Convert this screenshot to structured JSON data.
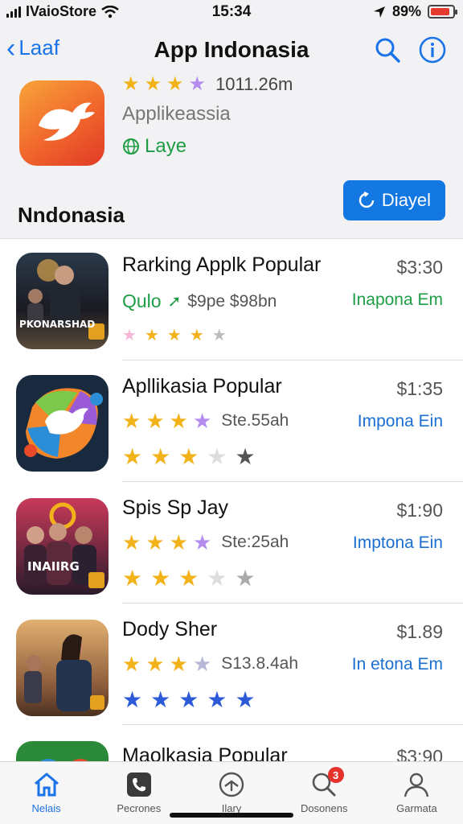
{
  "status": {
    "carrier": "IVaioStore",
    "time": "15:34",
    "battery": "89%",
    "battery_level": 0.89
  },
  "nav": {
    "back_label": "Laaf",
    "title": "App Indonasia",
    "search_icon": "search-icon",
    "info_icon": "info-icon"
  },
  "header": {
    "rating_value": "1011.26m",
    "stars": [
      "#f2b21a",
      "#f2b21a",
      "#f2b21a",
      "#b48cf0"
    ],
    "subtitle": "Applikeassia",
    "tag": "Laye",
    "tag_color": "#1f9d45",
    "install_label": "Diayel",
    "section_title": "Nndonasia"
  },
  "list": [
    {
      "title": "Rarking Applk Popular",
      "price": "$3:30",
      "logo": "Qulo",
      "meta": "$9pe $98bn",
      "link": "Inapona Em",
      "link_color": "#1f9d45",
      "stars": [
        "#f6b8d6",
        "#f2b21a",
        "#f2b21a",
        "#f2b21a",
        "#bbbbbb"
      ],
      "thumb_caption": "PKONARSHAD"
    },
    {
      "title": "Apllikasia Popular",
      "price": "$1:35",
      "meta": "Ste.55ah",
      "link": "Impona Ein",
      "link_color": "#1b6fd1",
      "stars": [
        "#f2b21a",
        "#f2b21a",
        "#f2b21a",
        "#b48cf0"
      ],
      "stars2": [
        "#f2b21a",
        "#f2b21a",
        "#f2b21a",
        "#dddddd",
        "#555555"
      ]
    },
    {
      "title": "Spis Sp Jay",
      "price": "$1:90",
      "meta": "Ste:25ah",
      "link": "Imptona Ein",
      "link_color": "#1b6fd1",
      "stars": [
        "#f2b21a",
        "#f2b21a",
        "#f2b21a",
        "#b48cf0"
      ],
      "stars2": [
        "#f2b21a",
        "#f2b21a",
        "#f2b21a",
        "#dddddd",
        "#aaaaaa"
      ],
      "thumb_caption": "INAIIRG"
    },
    {
      "title": "Dody Sher",
      "price": "$1.89",
      "meta": "S13.8.4ah",
      "link": "In etona Em",
      "link_color": "#1b6fd1",
      "stars": [
        "#f2b21a",
        "#f2b21a",
        "#f2b21a",
        "#b7b7d6"
      ],
      "stars2": [
        "#2d5bd8",
        "#2d5bd8",
        "#2d5bd8",
        "#2d5bd8",
        "#2d5bd8"
      ]
    },
    {
      "title": "Maolkasia Popular",
      "price": "$3:90"
    }
  ],
  "tabs": [
    {
      "label": "Nelais",
      "icon": "home-icon",
      "active": true
    },
    {
      "label": "Pecrones",
      "icon": "phone-icon"
    },
    {
      "label": "Ilary",
      "icon": "compass-icon"
    },
    {
      "label": "Dosonens",
      "icon": "search-icon",
      "badge": "3"
    },
    {
      "label": "Garmata",
      "icon": "person-icon"
    }
  ]
}
